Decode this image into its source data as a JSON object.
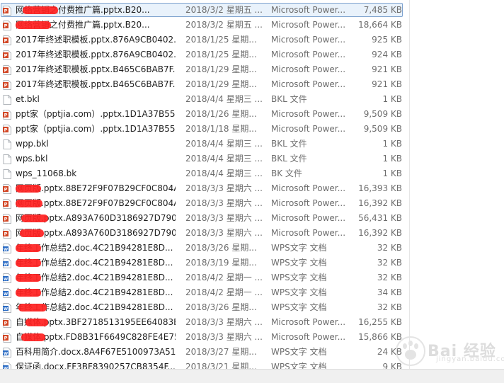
{
  "files": [
    {
      "name": "网络营销之付费推广篇.pptx.B20...",
      "date": "2018/3/2 星期五 ...",
      "type": "Microsoft Power...",
      "size": "7,485 KB",
      "icon": "pptx-icon",
      "selected": true,
      "redact": [
        [
          10,
          50
        ]
      ]
    },
    {
      "name": "网络营销之付费推广篇.pptx.B20...",
      "date": "2018/3/2 星期五 ...",
      "type": "Microsoft Power...",
      "size": "18,664 KB",
      "icon": "pptx-icon",
      "redact": [
        [
          0,
          50
        ]
      ]
    },
    {
      "name": "2017年终述职模板.pptx.876A9CB0402...",
      "date": "2018/1/25 星期...",
      "type": "Microsoft Power...",
      "size": "925 KB",
      "icon": "pptx-icon"
    },
    {
      "name": "2017年终述职模板.pptx.876A9CB0402...",
      "date": "2018/1/25 星期...",
      "type": "Microsoft Power...",
      "size": "924 KB",
      "icon": "pptx-icon"
    },
    {
      "name": "2017年终述职模板.pptx.B465C6BAB7F...",
      "date": "2018/1/29 星期...",
      "type": "Microsoft Power...",
      "size": "921 KB",
      "icon": "pptx-icon"
    },
    {
      "name": "2017年终述职模板.pptx.B465C6BAB7F...",
      "date": "2018/1/29 星期...",
      "type": "Microsoft Power...",
      "size": "921 KB",
      "icon": "pptx-icon"
    },
    {
      "name": "et.bkl",
      "date": "2018/4/4 星期三 ...",
      "type": "BKL 文件",
      "size": "1 KB",
      "icon": "file-icon"
    },
    {
      "name": "ppt家（pptjia.com）.pptx.1D1A37B55...",
      "date": "2018/1/26 星期...",
      "type": "Microsoft Power...",
      "size": "9,509 KB",
      "icon": "pptx-icon"
    },
    {
      "name": "ppt家（pptjia.com）.pptx.1D1A37B55...",
      "date": "2018/1/18 星期...",
      "type": "Microsoft Power...",
      "size": "9,509 KB",
      "icon": "pptx-icon"
    },
    {
      "name": "wpp.bkl",
      "date": "2018/4/4 星期三 ...",
      "type": "BKL 文件",
      "size": "1 KB",
      "icon": "file-icon"
    },
    {
      "name": "wps.bkl",
      "date": "2018/4/4 星期三 ...",
      "type": "BKL 文件",
      "size": "1 KB",
      "icon": "file-icon"
    },
    {
      "name": "wps_11068.bk",
      "date": "2018/4/4 星期三 ...",
      "type": "BK 文件",
      "size": "1 KB",
      "icon": "file-icon"
    },
    {
      "name": "网页版.pptx.88E72F9F07B29CF0C804A...",
      "date": "2018/3/3 星期六 ...",
      "type": "Microsoft Power...",
      "size": "16,393 KB",
      "icon": "pptx-icon",
      "redact": [
        [
          0,
          36
        ]
      ]
    },
    {
      "name": "网页版.pptx.88E72F9F07B29CF0C804A...",
      "date": "2018/3/3 星期六 ...",
      "type": "Microsoft Power...",
      "size": "16,392 KB",
      "icon": "pptx-icon",
      "redact": [
        [
          0,
          38
        ]
      ]
    },
    {
      "name": "网页版.pptx.A893A760D3186927D790...",
      "date": "2018/3/3 星期六 ...",
      "type": "Microsoft Power...",
      "size": "56,431 KB",
      "icon": "pptx-icon",
      "redact": [
        [
          8,
          38
        ]
      ]
    },
    {
      "name": "网页版.pptx.A893A760D3186927D790...",
      "date": "2018/3/3 星期六 ...",
      "type": "Microsoft Power...",
      "size": "16,392 KB",
      "icon": "pptx-icon",
      "redact": [
        [
          6,
          34
        ]
      ]
    },
    {
      "name": "年终工作总结2.doc.4C21B94281E8D...",
      "date": "2018/3/26 星期...",
      "type": "WPS文字 文档",
      "size": "32 KB",
      "icon": "doc-icon",
      "redact": [
        [
          0,
          36
        ]
      ]
    },
    {
      "name": "年终工作总结2.doc.4C21B94281E8D...",
      "date": "2018/3/19 星期...",
      "type": "WPS文字 文档",
      "size": "32 KB",
      "icon": "doc-icon",
      "redact": [
        [
          0,
          36
        ]
      ]
    },
    {
      "name": "年终工作总结2.doc.4C21B94281E8D...",
      "date": "2018/4/2 星期一 ...",
      "type": "WPS文字 文档",
      "size": "32 KB",
      "icon": "doc-icon",
      "redact": [
        [
          0,
          36
        ]
      ]
    },
    {
      "name": "年终工作总结2.doc.4C21B94281E8D...",
      "date": "2018/4/2 星期一 ...",
      "type": "WPS文字 文档",
      "size": "34 KB",
      "icon": "doc-icon",
      "redact": [
        [
          0,
          36
        ]
      ]
    },
    {
      "name": "年终工作总结2.doc.4C21B94281E8D...",
      "date": "2018/3/26 星期...",
      "type": "WPS文字 文档",
      "size": "32 KB",
      "icon": "doc-icon",
      "redact": [
        [
          4,
          40
        ]
      ]
    },
    {
      "name": "自媒体.pptx.3BF2718513195EE64083E...",
      "date": "2018/3/3 星期六 ...",
      "type": "Microsoft Power...",
      "size": "16,255 KB",
      "icon": "pptx-icon",
      "redact": [
        [
          14,
          32
        ]
      ]
    },
    {
      "name": "自媒体.pptx.FD8B31F6649C828FE4E75...",
      "date": "2018/3/3 星期六 ...",
      "type": "Microsoft Power...",
      "size": "15,866 KB",
      "icon": "pptx-icon",
      "redact": [
        [
          8,
          34
        ]
      ]
    },
    {
      "name": "百科用简介.docx.8A4F67E5100973A51...",
      "date": "2018/3/27 星期...",
      "type": "WPS文字 文档",
      "size": "24 KB",
      "icon": "doc-icon"
    },
    {
      "name": "保证函.docx.FF3BF8390257CB8354F...",
      "date": "2018/3/21 星期...",
      "type": "WPS文字 文档",
      "size": "9 KB",
      "icon": "doc-icon"
    }
  ],
  "watermark": {
    "line1": "Bai 经验",
    "line2": "jingyan.baidu.com"
  }
}
